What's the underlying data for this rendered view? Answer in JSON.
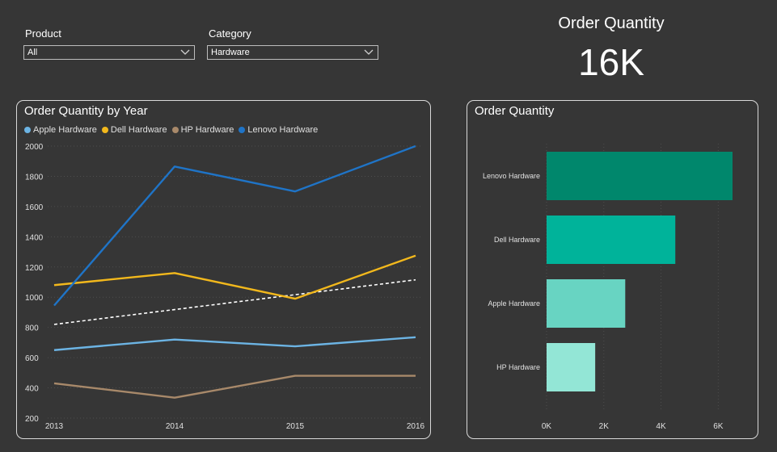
{
  "slicers": [
    {
      "label": "Product",
      "value": "All"
    },
    {
      "label": "Category",
      "value": "Hardware"
    }
  ],
  "kpi": {
    "title": "Order Quantity",
    "value": "16K"
  },
  "colors": {
    "apple": "#6cb4e4",
    "dell": "#f2b81c",
    "hp": "#a8896a",
    "lenovo": "#1f74c7",
    "trend": "#ffffff",
    "bars": [
      "#00876c",
      "#00b39a",
      "#68d4c2",
      "#93e6d6"
    ]
  },
  "chart_data": [
    {
      "type": "line",
      "title": "Order Quantity by Year",
      "x": [
        "2013",
        "2014",
        "2015",
        "2016"
      ],
      "series": [
        {
          "name": "Apple Hardware",
          "values": [
            650,
            720,
            675,
            735
          ]
        },
        {
          "name": "Dell Hardware",
          "values": [
            1080,
            1160,
            990,
            1275
          ]
        },
        {
          "name": "HP Hardware",
          "values": [
            430,
            335,
            480,
            480
          ]
        },
        {
          "name": "Lenovo Hardware",
          "values": [
            945,
            1865,
            1700,
            2000
          ]
        }
      ],
      "trend_line": {
        "values": [
          820,
          1115
        ]
      },
      "yticks": [
        200,
        400,
        600,
        800,
        1000,
        1200,
        1400,
        1600,
        1800,
        2000
      ],
      "ylim": [
        200,
        2000
      ],
      "grid": true,
      "legend": "top-left"
    },
    {
      "type": "bar",
      "orientation": "horizontal",
      "title": "Order Quantity",
      "categories": [
        "Lenovo Hardware",
        "Dell Hardware",
        "Apple Hardware",
        "HP Hardware"
      ],
      "values": [
        6500,
        4500,
        2750,
        1700
      ],
      "xticks": [
        "0K",
        "2K",
        "4K",
        "6K"
      ],
      "xlim": [
        0,
        6700
      ],
      "grid": true
    }
  ]
}
